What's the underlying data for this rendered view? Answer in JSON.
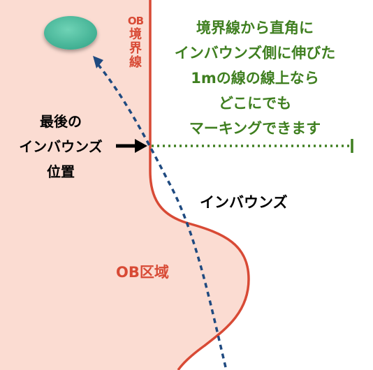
{
  "labels": {
    "ob_boundary": "OB境界線",
    "note_lines": [
      "境界線から直角に",
      "インバウンズ側に伸びた",
      "1mの線の線上なら",
      "どこにでも",
      "マーキングできます"
    ],
    "last_position_lines": [
      "最後の",
      "インバウンズ",
      "位置"
    ],
    "inbounds": "インバウンズ",
    "ob_area": "OB区域"
  },
  "colors": {
    "ob_area_fill": "#fbdcd2",
    "boundary_line": "#d84a35",
    "trajectory": "#1f4a80",
    "marking_line": "#3f7f20",
    "ball": "#52c0a2",
    "arrow": "#000000"
  }
}
